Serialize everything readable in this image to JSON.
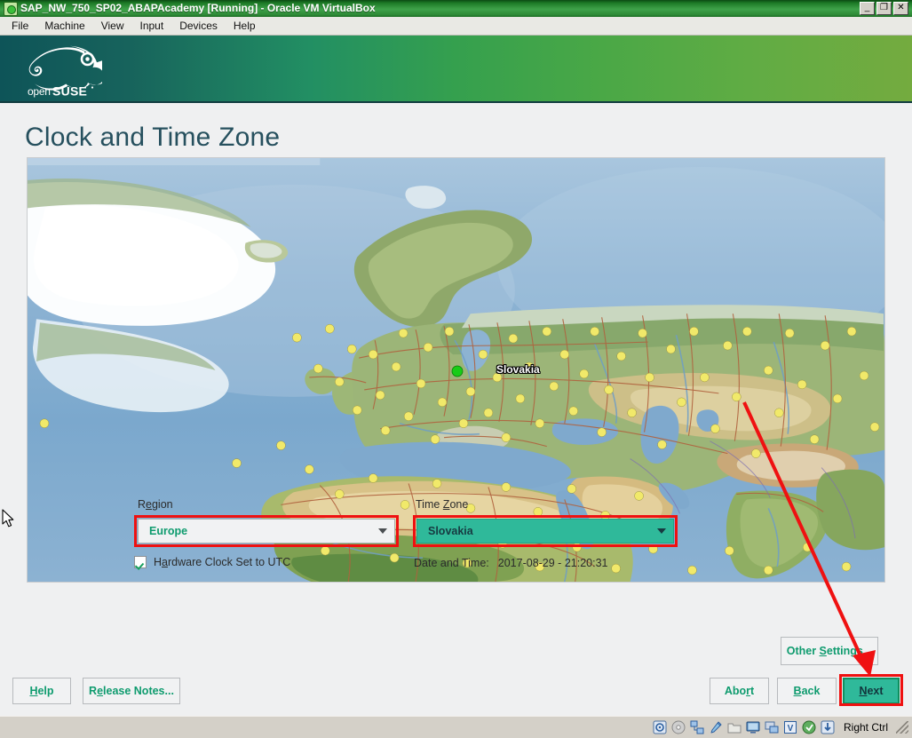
{
  "vm_window": {
    "title": "SAP_NW_750_SP02_ABAPAcademy [Running] - Oracle VM VirtualBox",
    "icon": "virtualbox-vm-icon",
    "controls": {
      "minimize": "_",
      "maximize": "❐",
      "close": "✕"
    },
    "menus": [
      {
        "label": "File"
      },
      {
        "label": "Machine"
      },
      {
        "label": "View"
      },
      {
        "label": "Input"
      },
      {
        "label": "Devices"
      },
      {
        "label": "Help"
      }
    ],
    "statusbar": {
      "icons": [
        "hard-disk-icon",
        "optical-disk-icon",
        "network-icon",
        "usb-icon",
        "shared-folder-icon",
        "display-icon",
        "remote-desktop-icon",
        "virtualization-icon",
        "mouse-integration-icon",
        "host-key-icon"
      ],
      "host_key": "Right Ctrl"
    }
  },
  "installer": {
    "branding": {
      "logo_text": "openSUSE",
      "logo_alt": "opensuse-chameleon-logo",
      "gradient_from": "#0e5458",
      "gradient_to": "#74ab3f"
    },
    "page_title": "Clock and Time Zone",
    "map": {
      "alt": "world-map-timezones",
      "selected_city_label": "Slovakia",
      "selected_dot_color": "#18cc18",
      "city_dot_color": "#f1e96a"
    },
    "region": {
      "label_before": "R",
      "label_mnemonic": "e",
      "label_after": "gion",
      "label_full": "Region",
      "value": "Europe"
    },
    "timezone": {
      "label_before": "Time ",
      "label_mnemonic": "Z",
      "label_after": "one",
      "label_full": "Time Zone",
      "value": "Slovakia",
      "focused": true,
      "focus_color": "#2fb99a"
    },
    "hardware_clock": {
      "label_before": "H",
      "label_mnemonic": "a",
      "label_after": "rdware Clock Set to UTC",
      "label_full": "Hardware Clock Set to UTC",
      "checked": true
    },
    "datetime": {
      "label": "Date and Time:",
      "value": "2017-08-29 - 21:20:31"
    },
    "buttons": {
      "other_settings": {
        "before": "Other ",
        "mnemonic": "S",
        "after": "ettings...",
        "full": "Other Settings..."
      },
      "help": {
        "before": "",
        "mnemonic": "H",
        "after": "elp",
        "full": "Help"
      },
      "release_notes": {
        "before": "R",
        "mnemonic": "e",
        "after": "lease Notes...",
        "full": "Release Notes..."
      },
      "abort": {
        "before": "Abo",
        "mnemonic": "r",
        "after": "t",
        "full": "Abort"
      },
      "back": {
        "before": "",
        "mnemonic": "B",
        "after": "ack",
        "full": "Back"
      },
      "next": {
        "before": "",
        "mnemonic": "N",
        "after": "ext",
        "full": "Next"
      }
    },
    "annotations": {
      "highlight_color": "#ef1111",
      "boxes": [
        "region-combo",
        "timezone-combo",
        "next-button"
      ],
      "arrow": "points from map to Next button"
    }
  }
}
